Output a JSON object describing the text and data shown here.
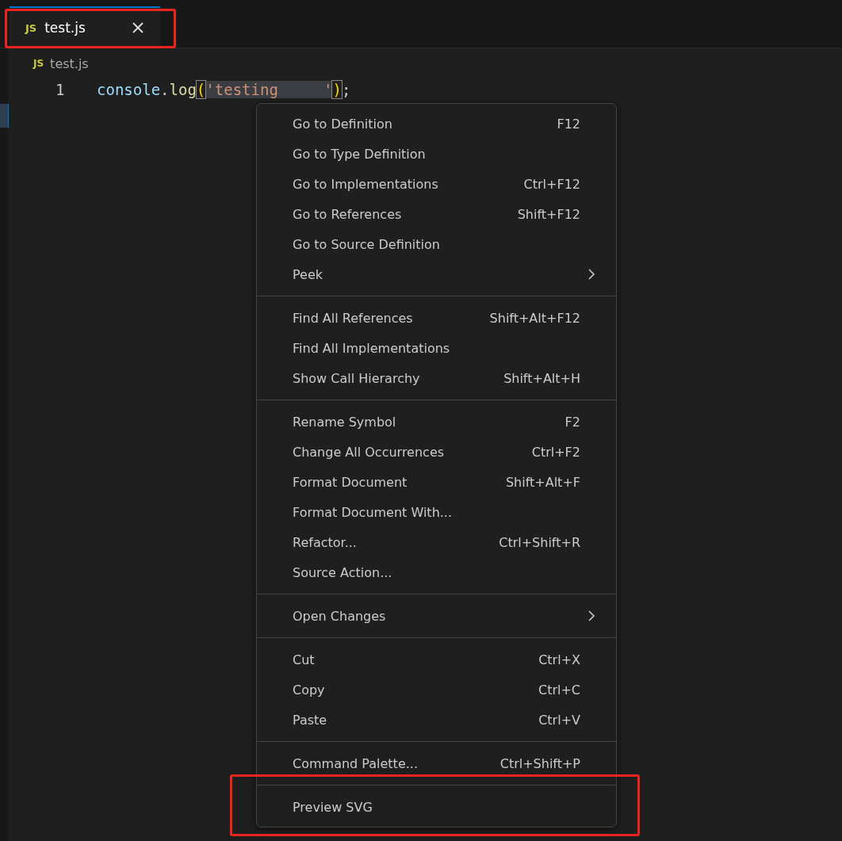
{
  "tabs": [
    {
      "label": "test.js",
      "icon": "JS",
      "selected": true,
      "highlighted": true
    }
  ],
  "breadcrumb": {
    "icon": "JS",
    "label": "test.js"
  },
  "editor": {
    "lines": [
      {
        "number": "1",
        "tokens": [
          {
            "kind": "variable",
            "text": "console"
          },
          {
            "kind": "punct",
            "text": "."
          },
          {
            "kind": "function",
            "text": "log"
          },
          {
            "kind": "bracket",
            "text": "("
          },
          {
            "kind": "string",
            "text": "'testing     '",
            "selected": true
          },
          {
            "kind": "bracket",
            "text": ")"
          },
          {
            "kind": "punct",
            "text": ";"
          }
        ]
      }
    ]
  },
  "context_menu": {
    "groups": [
      [
        {
          "label": "Go to Definition",
          "shortcut": "F12",
          "submenu": false,
          "highlighted": false
        },
        {
          "label": "Go to Type Definition",
          "submenu": false,
          "highlighted": false
        },
        {
          "label": "Go to Implementations",
          "shortcut": "Ctrl+F12",
          "submenu": false,
          "highlighted": false
        },
        {
          "label": "Go to References",
          "shortcut": "Shift+F12",
          "submenu": false,
          "highlighted": false
        },
        {
          "label": "Go to Source Definition",
          "submenu": false,
          "highlighted": false
        },
        {
          "label": "Peek",
          "submenu": true,
          "highlighted": false
        }
      ],
      [
        {
          "label": "Find All References",
          "shortcut": "Shift+Alt+F12",
          "submenu": false,
          "highlighted": false
        },
        {
          "label": "Find All Implementations",
          "submenu": false,
          "highlighted": false
        },
        {
          "label": "Show Call Hierarchy",
          "shortcut": "Shift+Alt+H",
          "submenu": false,
          "highlighted": false
        }
      ],
      [
        {
          "label": "Rename Symbol",
          "shortcut": "F2",
          "submenu": false,
          "highlighted": false
        },
        {
          "label": "Change All Occurrences",
          "shortcut": "Ctrl+F2",
          "submenu": false,
          "highlighted": false
        },
        {
          "label": "Format Document",
          "shortcut": "Shift+Alt+F",
          "submenu": false,
          "highlighted": false
        },
        {
          "label": "Format Document With...",
          "submenu": false,
          "highlighted": false
        },
        {
          "label": "Refactor...",
          "shortcut": "Ctrl+Shift+R",
          "submenu": false,
          "highlighted": false
        },
        {
          "label": "Source Action...",
          "submenu": false,
          "highlighted": false
        }
      ],
      [
        {
          "label": "Open Changes",
          "submenu": true,
          "highlighted": false
        }
      ],
      [
        {
          "label": "Cut",
          "shortcut": "Ctrl+X",
          "submenu": false,
          "highlighted": false
        },
        {
          "label": "Copy",
          "shortcut": "Ctrl+C",
          "submenu": false,
          "highlighted": false
        },
        {
          "label": "Paste",
          "shortcut": "Ctrl+V",
          "submenu": false,
          "highlighted": false
        }
      ],
      [
        {
          "label": "Command Palette...",
          "shortcut": "Ctrl+Shift+P",
          "submenu": false,
          "highlighted": false
        }
      ],
      [
        {
          "label": "Preview SVG",
          "submenu": false,
          "highlighted": true
        }
      ]
    ]
  }
}
